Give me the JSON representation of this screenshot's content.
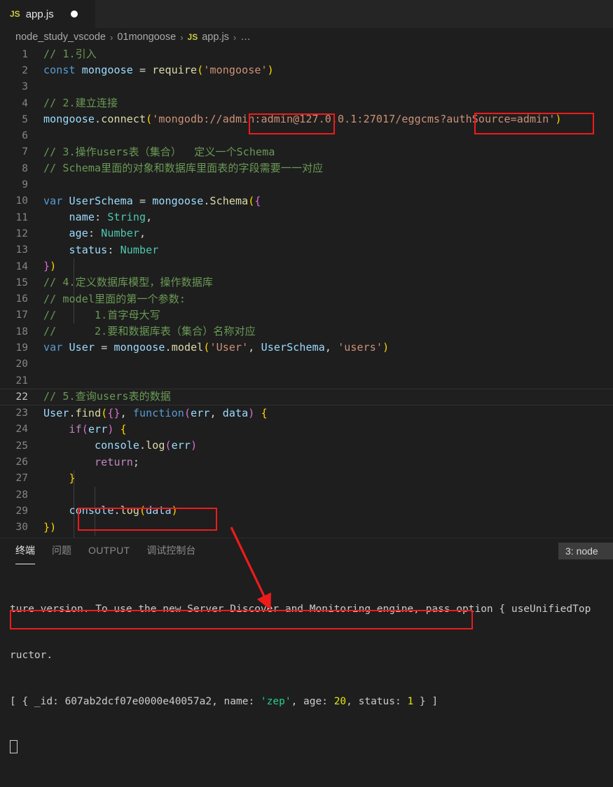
{
  "window": {
    "tab": {
      "icon_label": "JS",
      "filename": "app.js",
      "dirty": true
    }
  },
  "breadcrumb": {
    "items": [
      "node_study_vscode",
      "01mongoose",
      "app.js",
      "…"
    ],
    "file_icon_label": "JS",
    "separator": "›"
  },
  "editor": {
    "language": "javascript",
    "active_line": 22,
    "lines": [
      {
        "n": 1,
        "text": "// 1.引入"
      },
      {
        "n": 2,
        "text": "const mongoose = require('mongoose')"
      },
      {
        "n": 3,
        "text": ""
      },
      {
        "n": 4,
        "text": "// 2.建立连接"
      },
      {
        "n": 5,
        "text": "mongoose.connect('mongodb://admin:admin@127.0.0.1:27017/eggcms?authSource=admin')"
      },
      {
        "n": 6,
        "text": ""
      },
      {
        "n": 7,
        "text": "// 3.操作users表（集合）  定义一个Schema"
      },
      {
        "n": 8,
        "text": "// Schema里面的对象和数据库里面表的字段需要一一对应"
      },
      {
        "n": 9,
        "text": ""
      },
      {
        "n": 10,
        "text": "var UserSchema = mongoose.Schema({"
      },
      {
        "n": 11,
        "text": "    name: String,"
      },
      {
        "n": 12,
        "text": "    age: Number,"
      },
      {
        "n": 13,
        "text": "    status: Number"
      },
      {
        "n": 14,
        "text": "})"
      },
      {
        "n": 15,
        "text": "// 4.定义数据库模型，操作数据库"
      },
      {
        "n": 16,
        "text": "// model里面的第一个参数:"
      },
      {
        "n": 17,
        "text": "//      1.首字母大写"
      },
      {
        "n": 18,
        "text": "//      2.要和数据库表（集合）名称对应"
      },
      {
        "n": 19,
        "text": "var User = mongoose.model('User', UserSchema, 'users')"
      },
      {
        "n": 20,
        "text": ""
      },
      {
        "n": 21,
        "text": ""
      },
      {
        "n": 22,
        "text": "// 5.查询users表的数据"
      },
      {
        "n": 23,
        "text": "User.find({}, function(err, data) {"
      },
      {
        "n": 24,
        "text": "    if(err) {"
      },
      {
        "n": 25,
        "text": "        console.log(err)"
      },
      {
        "n": 26,
        "text": "        return;"
      },
      {
        "n": 27,
        "text": "    }"
      },
      {
        "n": 28,
        "text": ""
      },
      {
        "n": 29,
        "text": "    console.log(data)"
      },
      {
        "n": 30,
        "text": "})"
      }
    ]
  },
  "annotations": {
    "color": "#ee1b1b",
    "boxes": [
      {
        "name": "credentials-highlight",
        "text": "admin:admin@"
      },
      {
        "name": "authsource-highlight",
        "text": "?authSource=admin"
      },
      {
        "name": "console-log-data-highlight",
        "text": "console.log(data)"
      },
      {
        "name": "terminal-result-highlight",
        "text": "[ { _id: 607ab2dcf07e0000e40057a2, name: 'zep', age: 20, status: 1 } ]"
      }
    ],
    "arrow": {
      "name": "pointer-arrow",
      "from": "console.log(data)",
      "to": "terminal output row"
    }
  },
  "panel": {
    "tabs": [
      {
        "label": "终端",
        "active": true
      },
      {
        "label": "问题",
        "active": false
      },
      {
        "label": "OUTPUT",
        "active": false
      },
      {
        "label": "调试控制台",
        "active": false
      }
    ],
    "terminal_selector": "3: node",
    "output": {
      "line1": "ture version. To use the new Server Discover and Monitoring engine, pass option { useUnifiedTop",
      "line2": "ructor.",
      "result_prefix": "[ { _id: 607ab2dcf07e0000e40057a2, name: ",
      "result_name": "'zep'",
      "result_mid": ", age: ",
      "result_age": "20",
      "result_mid2": ", status: ",
      "result_status": "1",
      "result_suffix": " } ]"
    }
  }
}
